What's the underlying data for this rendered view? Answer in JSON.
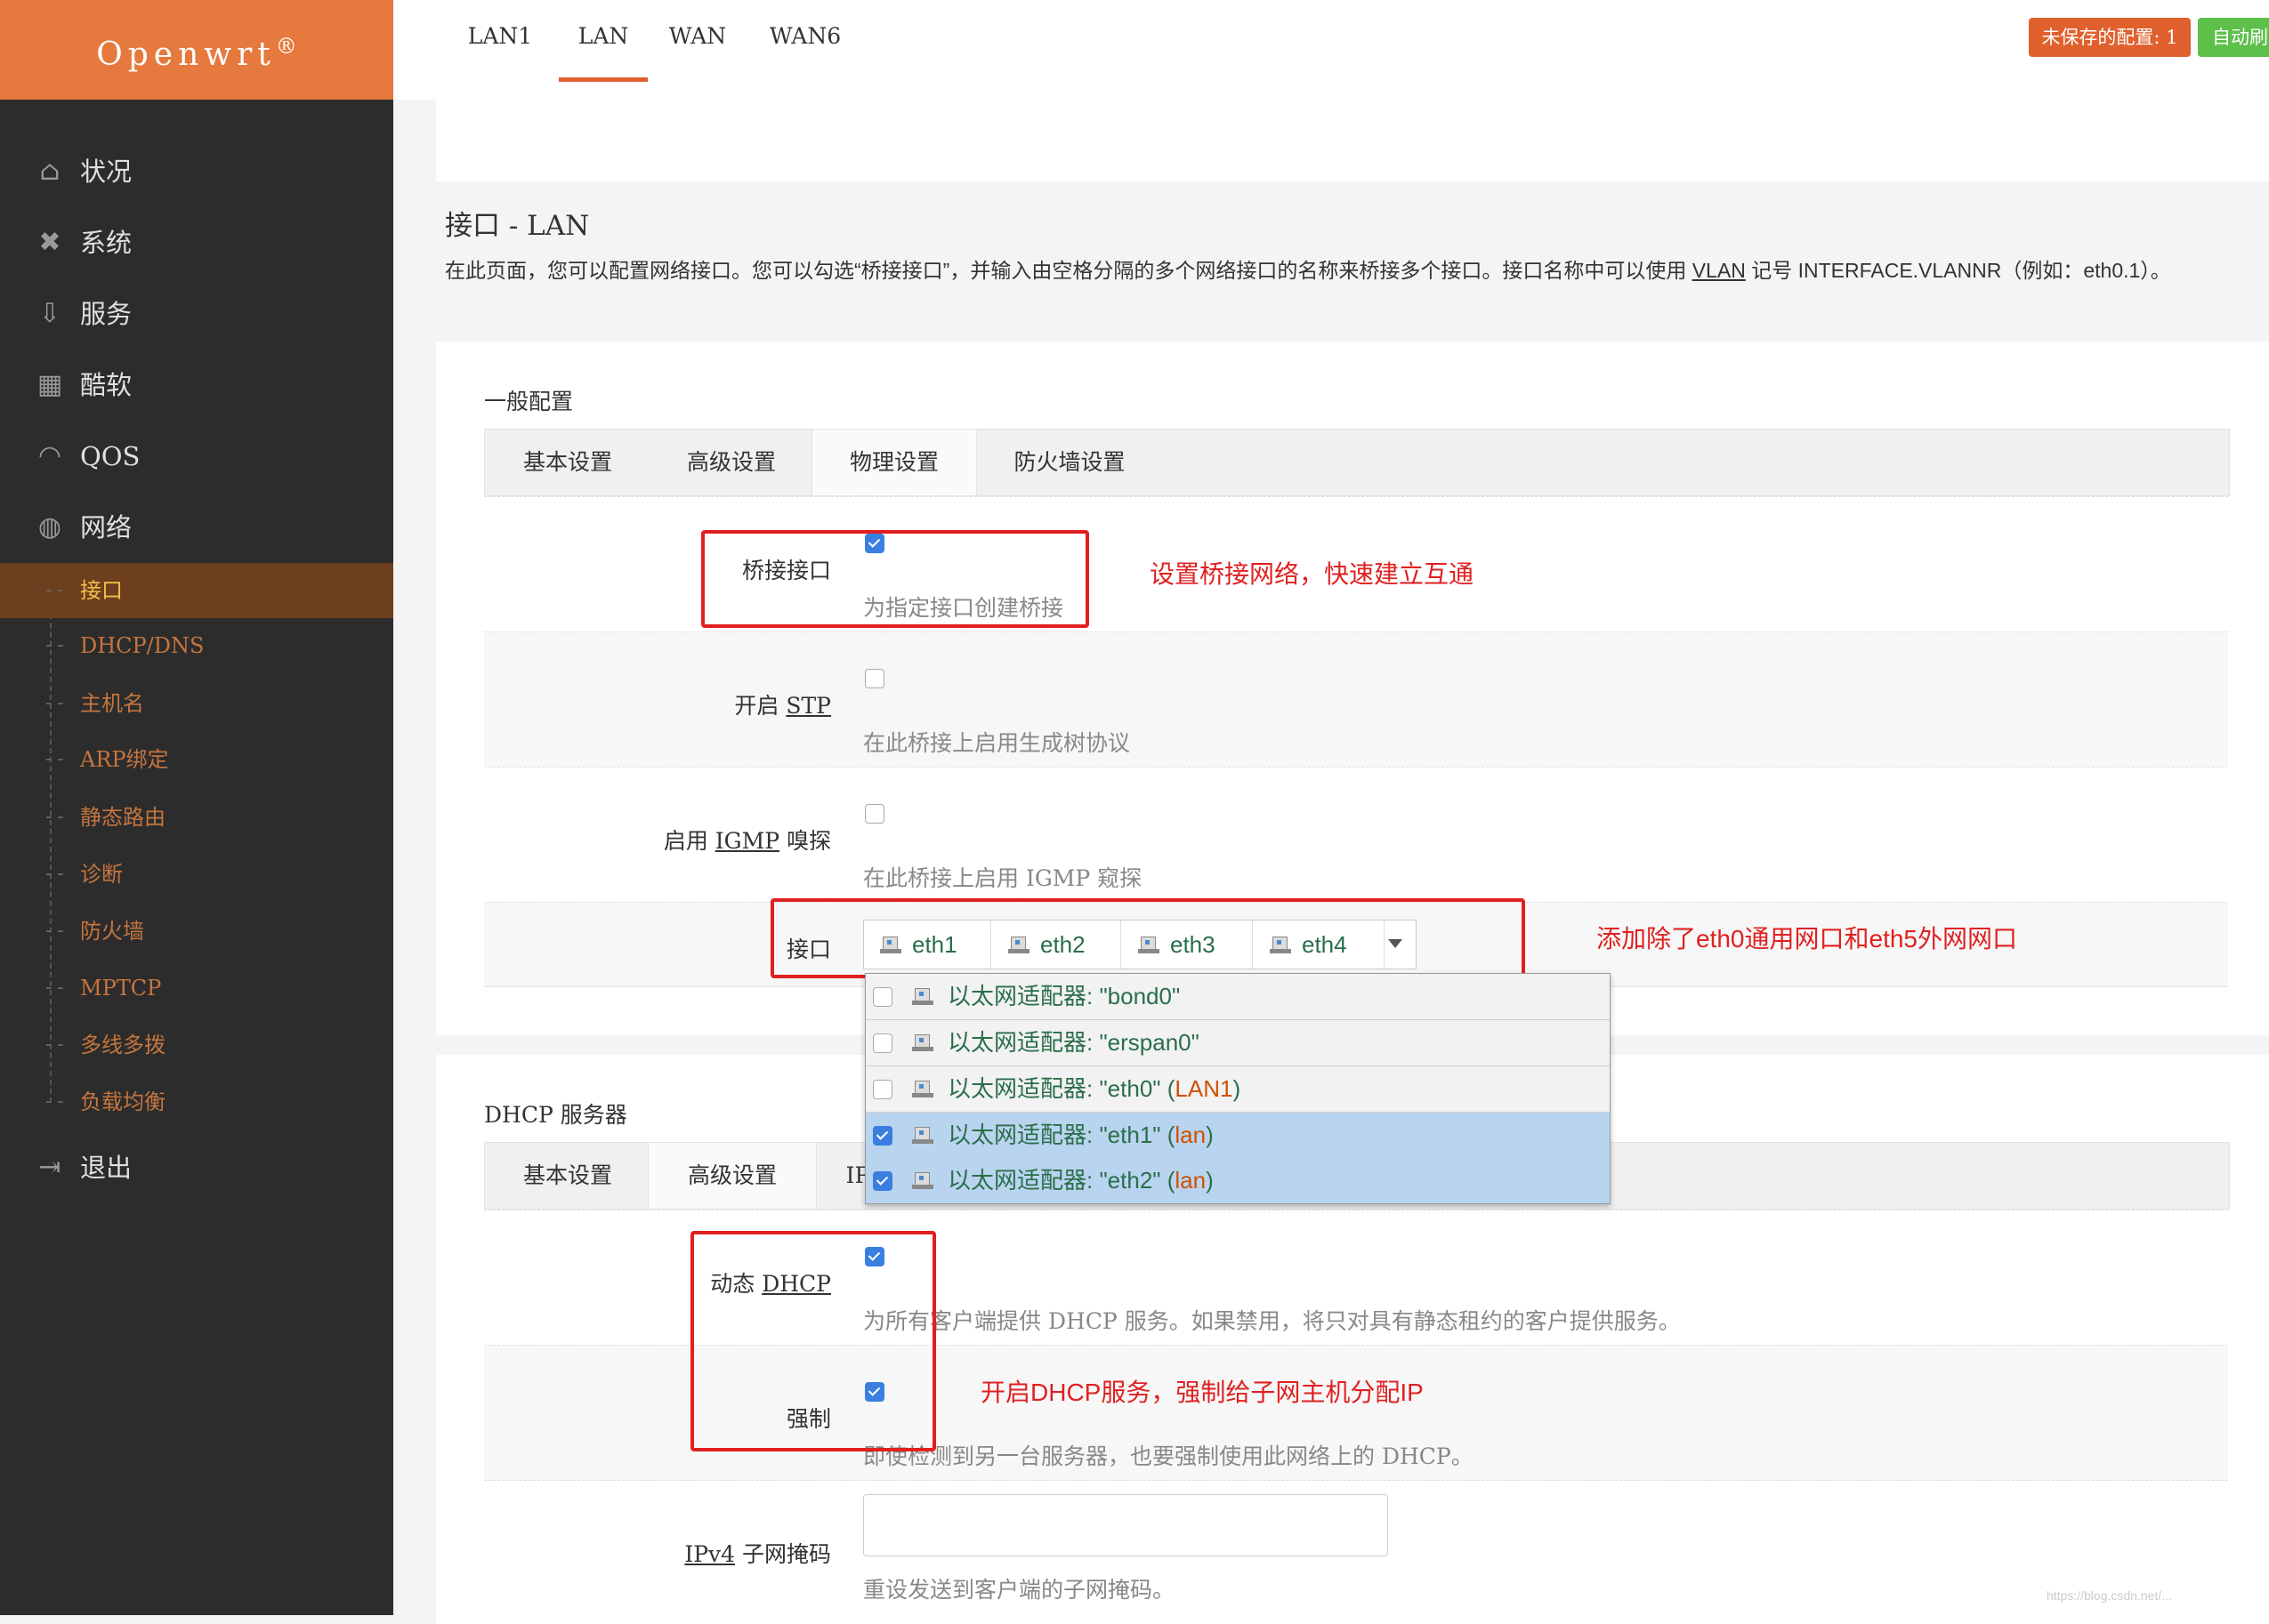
{
  "brand": {
    "name": "Openwrt",
    "mark": "®"
  },
  "header": {
    "unsaved": "未保存的配置: 1",
    "autorefresh": "自动刷"
  },
  "sidebar": {
    "items": [
      {
        "label": "状况",
        "icon": "home-icon",
        "glyph": "⌂"
      },
      {
        "label": "系统",
        "icon": "tools-icon",
        "glyph": "✖"
      },
      {
        "label": "服务",
        "icon": "download-icon",
        "glyph": "⇩"
      },
      {
        "label": "酷软",
        "icon": "calendar-icon",
        "glyph": "▦"
      },
      {
        "label": "QOS",
        "icon": "gauge-icon",
        "glyph": "◠"
      },
      {
        "label": "网络",
        "icon": "globe-icon",
        "glyph": "◍"
      }
    ],
    "subitems": [
      "接口",
      "DHCP/DNS",
      "主机名",
      "ARP绑定",
      "静态路由",
      "诊断",
      "防火墙",
      "MPTCP",
      "多线多拨",
      "负载均衡"
    ],
    "logout": {
      "label": "退出",
      "icon": "logout-icon",
      "glyph": "⇥"
    }
  },
  "page_tabs": [
    "LAN1",
    "LAN",
    "WAN",
    "WAN6"
  ],
  "title": "接口 - LAN",
  "desc": {
    "part1": "在此页面，您可以配置网络接口。您可以勾选“桥接接口”，并输入由空格分隔的多个网络接口的名称来桥接多个接口。接口名称中可以使用 ",
    "vlan": "VLAN",
    "part2": " 记号 INTERFACE.VLANNR（例如：eth0.1）。"
  },
  "general": {
    "title": "一般配置",
    "tabs": [
      "基本设置",
      "高级设置",
      "物理设置",
      "防火墙设置"
    ],
    "bridge": {
      "label": "桥接接口",
      "help": "为指定接口创建桥接",
      "checked": true
    },
    "stp": {
      "label_prefix": "开启 ",
      "label_abbr": "STP",
      "help": "在此桥接上启用生成树协议",
      "checked": false
    },
    "igmp": {
      "label_prefix": "启用 ",
      "label_abbr": "IGMP",
      "label_suffix": " 嗅探",
      "help": "在此桥接上启用 IGMP 窥探",
      "checked": false
    },
    "iface": {
      "label": "接口",
      "chips": [
        "eth1",
        "eth2",
        "eth3",
        "eth4"
      ]
    }
  },
  "dropdown": [
    {
      "text": "以太网适配器: \"bond0\"",
      "zone": "",
      "checked": false
    },
    {
      "text": "以太网适配器: \"erspan0\"",
      "zone": "",
      "checked": false
    },
    {
      "text": "以太网适配器: \"eth0\" (",
      "zone": "LAN1",
      "close": ")",
      "checked": false
    },
    {
      "text": "以太网适配器: \"eth1\" (",
      "zone": "lan",
      "close": ")",
      "checked": true
    },
    {
      "text": "以太网适配器: \"eth2\" (",
      "zone": "lan",
      "close": ")",
      "checked": true
    }
  ],
  "dhcp": {
    "title": "DHCP 服务器",
    "tabs": [
      "基本设置",
      "高级设置",
      "IP"
    ],
    "dynamic": {
      "label_prefix": "动态 ",
      "label_abbr": "DHCP",
      "help": "为所有客户端提供 DHCP 服务。如果禁用，将只对具有静态租约的客户提供服务。",
      "checked": true
    },
    "force": {
      "label": "强制",
      "help": "即使检测到另一台服务器，也要强制使用此网络上的 DHCP。",
      "checked": true
    },
    "netmask": {
      "label_abbr": "IPv4",
      "label_suffix": " 子网掩码",
      "help": "重设发送到客户端的子网掩码。",
      "value": ""
    }
  },
  "notes": {
    "bridge": "设置桥接网络，快速建立互通",
    "iface": "添加除了eth0通用网口和eth5外网网口",
    "dhcp": "开启DHCP服务，强制给子网主机分配IP"
  },
  "watermark": "https://blog.csdn.net/..."
}
